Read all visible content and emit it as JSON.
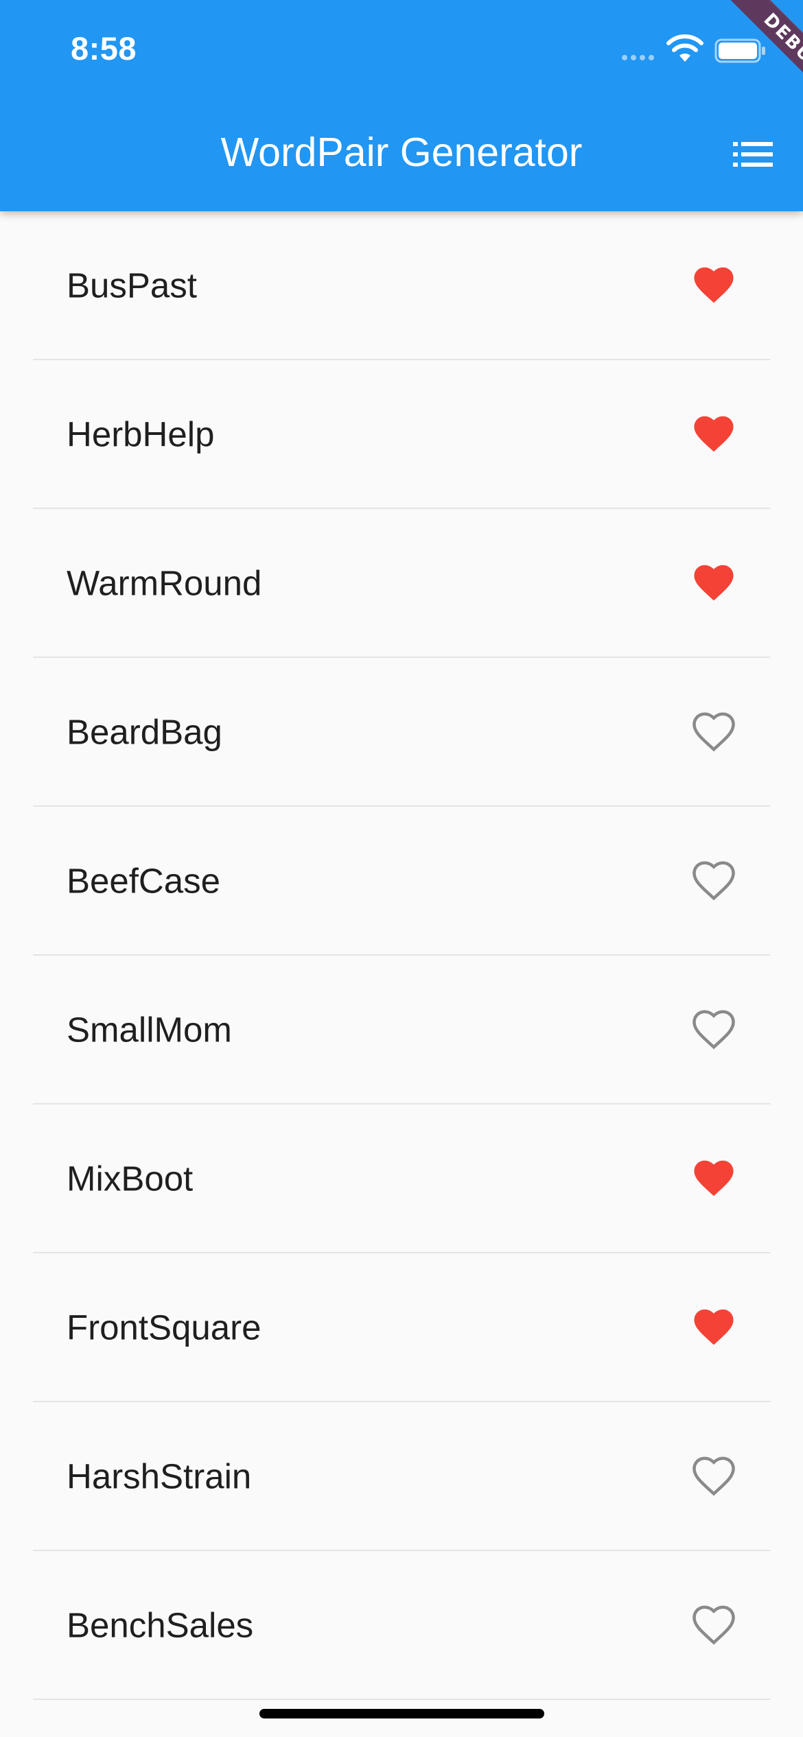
{
  "status_bar": {
    "time": "8:58"
  },
  "app_bar": {
    "title": "WordPair Generator",
    "action_icon": "list-icon",
    "color": "#2196f3"
  },
  "debug_banner": {
    "label": "DEBUG"
  },
  "favorite_color": "#f44336",
  "unfavorite_color": "#8a8a8a",
  "word_pairs": [
    {
      "text": "BusPast",
      "saved": true
    },
    {
      "text": "HerbHelp",
      "saved": true
    },
    {
      "text": "WarmRound",
      "saved": true
    },
    {
      "text": "BeardBag",
      "saved": false
    },
    {
      "text": "BeefCase",
      "saved": false
    },
    {
      "text": "SmallMom",
      "saved": false
    },
    {
      "text": "MixBoot",
      "saved": true
    },
    {
      "text": "FrontSquare",
      "saved": true
    },
    {
      "text": "HarshStrain",
      "saved": false
    },
    {
      "text": "BenchSales",
      "saved": false
    }
  ]
}
